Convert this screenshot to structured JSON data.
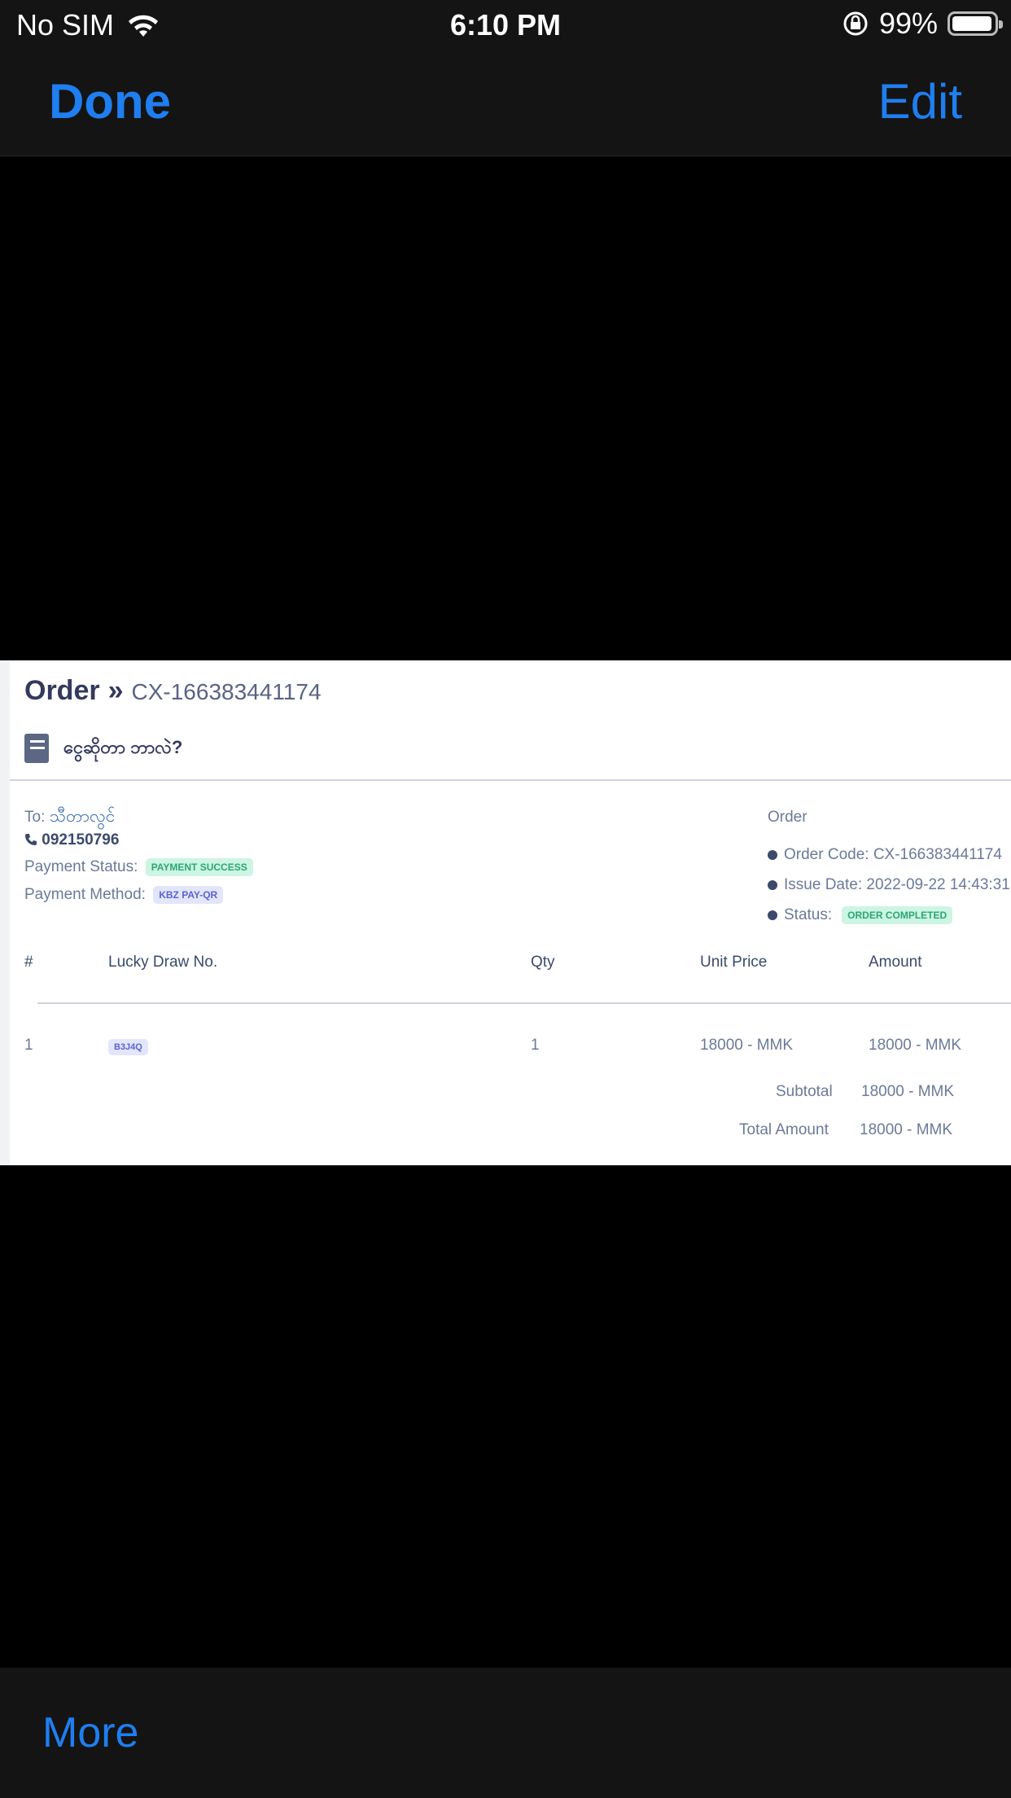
{
  "status_bar": {
    "carrier": "No SIM",
    "time": "6:10 PM",
    "battery": "99%"
  },
  "nav": {
    "done": "Done",
    "edit": "Edit"
  },
  "toolbar": {
    "more": "More"
  },
  "document": {
    "title": "Order",
    "chevron": "»",
    "code": "CX-166383441174",
    "subtitle": "ငွေဆိုတာ ဘာလဲ?",
    "to_label": "To:",
    "to_name": "သီတာလွင်",
    "phone": "092150796",
    "payment_status_label": "Payment Status:",
    "payment_status": "PAYMENT SUCCESS",
    "payment_method_label": "Payment Method:",
    "payment_method": "KBZ PAY-QR",
    "order_heading": "Order",
    "order_code": "Order Code: CX-166383441174",
    "issue_date": "Issue Date: 2022-09-22 14:43:31",
    "status_label": "Status:",
    "status": "ORDER COMPLETED",
    "table": {
      "headers": {
        "num": "#",
        "lucky": "Lucky Draw No.",
        "qty": "Qty",
        "unit": "Unit Price",
        "amount": "Amount"
      },
      "rows": [
        {
          "num": "1",
          "lucky": "B3J4Q",
          "qty": "1",
          "unit": "18000 - MMK",
          "amount": "18000 - MMK"
        }
      ]
    },
    "subtotal_label": "Subtotal",
    "subtotal": "18000 - MMK",
    "total_label": "Total Amount",
    "total": "18000 - MMK"
  }
}
